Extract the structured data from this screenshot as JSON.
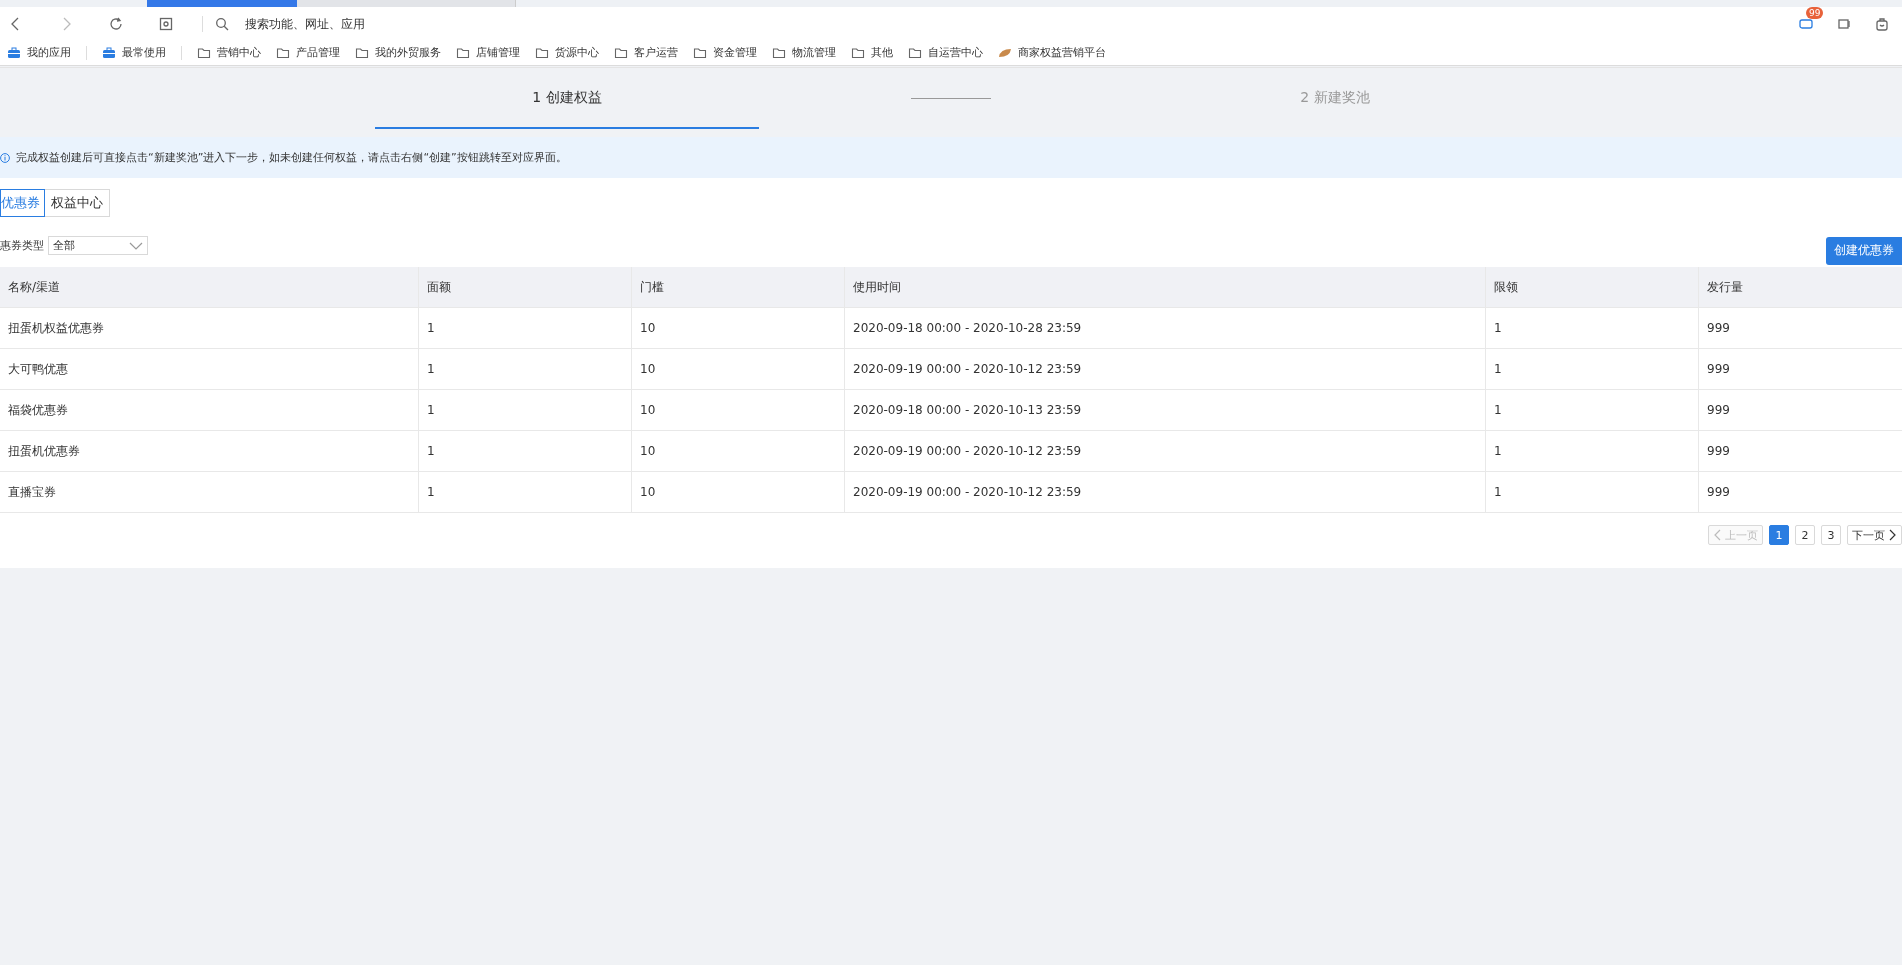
{
  "browser": {
    "search_placeholder": "搜索功能、网址、应用",
    "badge": "99"
  },
  "bookmarks": [
    {
      "label": "我的应用",
      "kind": "app"
    },
    {
      "label": "最常使用",
      "kind": "app"
    },
    {
      "label": "营销中心",
      "kind": "folder"
    },
    {
      "label": "产品管理",
      "kind": "folder"
    },
    {
      "label": "我的外贸服务",
      "kind": "folder"
    },
    {
      "label": "店铺管理",
      "kind": "folder"
    },
    {
      "label": "货源中心",
      "kind": "folder"
    },
    {
      "label": "客户运营",
      "kind": "folder"
    },
    {
      "label": "资金管理",
      "kind": "folder"
    },
    {
      "label": "物流管理",
      "kind": "folder"
    },
    {
      "label": "其他",
      "kind": "folder"
    },
    {
      "label": "自运营中心",
      "kind": "folder"
    },
    {
      "label": "商家权益营销平台",
      "kind": "leaf"
    }
  ],
  "steps": [
    {
      "label": "1 创建权益",
      "selected": true
    },
    {
      "label": "2 新建奖池",
      "selected": false
    }
  ],
  "notice": "完成权益创建后可直接点击“新建奖池”进入下一步，如未创建任何权益，请点击右侧“创建”按钮跳转至对应界面。",
  "tabs": [
    {
      "label": "优惠券",
      "selected": true
    },
    {
      "label": "权益中心",
      "selected": false
    }
  ],
  "filter": {
    "label": "惠券类型",
    "value": "全部"
  },
  "create_button": "创建优惠券",
  "table": {
    "columns": [
      "名称/渠道",
      "面额",
      "门槛",
      "使用时间",
      "限领",
      "发行量"
    ],
    "rows": [
      [
        "扭蛋机权益优惠券",
        "1",
        "10",
        "2020-09-18 00:00 - 2020-10-28 23:59",
        "1",
        "999"
      ],
      [
        "大可鸭优惠",
        "1",
        "10",
        "2020-09-19 00:00 - 2020-10-12 23:59",
        "1",
        "999"
      ],
      [
        "福袋优惠券",
        "1",
        "10",
        "2020-09-18 00:00 - 2020-10-13 23:59",
        "1",
        "999"
      ],
      [
        "扭蛋机优惠券",
        "1",
        "10",
        "2020-09-19 00:00 - 2020-10-12 23:59",
        "1",
        "999"
      ],
      [
        "直播宝券",
        "1",
        "10",
        "2020-09-19 00:00 - 2020-10-12 23:59",
        "1",
        "999"
      ]
    ]
  },
  "pagination": {
    "prev": "上一页",
    "prev_disabled": true,
    "next": "下一页",
    "pages": [
      {
        "label": "1",
        "selected": true
      },
      {
        "label": "2",
        "selected": false
      },
      {
        "label": "3",
        "selected": false
      }
    ]
  }
}
